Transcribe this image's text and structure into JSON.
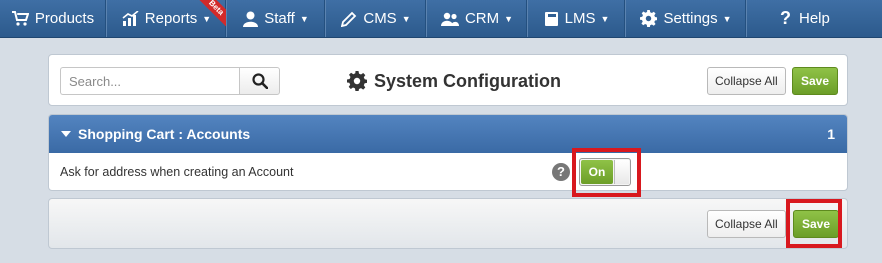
{
  "nav": {
    "items": [
      {
        "label": "Products",
        "icon": "cart-icon",
        "caret": false
      },
      {
        "label": "Reports",
        "icon": "chart-icon",
        "caret": true,
        "badge": "Beta"
      },
      {
        "label": "Staff",
        "icon": "person-icon",
        "caret": true
      },
      {
        "label": "CMS",
        "icon": "pencil-icon",
        "caret": true
      },
      {
        "label": "CRM",
        "icon": "people-icon",
        "caret": true
      },
      {
        "label": "LMS",
        "icon": "book-icon",
        "caret": true
      },
      {
        "label": "Settings",
        "icon": "gear-icon",
        "caret": true
      },
      {
        "label": "Help",
        "icon": "question-icon",
        "caret": false
      }
    ]
  },
  "toolbar": {
    "search_placeholder": "Search...",
    "title": "System Configuration",
    "collapse_label": "Collapse All",
    "save_label": "Save"
  },
  "section": {
    "title": "Shopping Cart : Accounts",
    "count": "1",
    "setting": {
      "label": "Ask for address when creating an Account",
      "help": "?",
      "toggle_label": "On",
      "toggle_state": true
    }
  },
  "footer": {
    "collapse_label": "Collapse All",
    "save_label": "Save"
  },
  "colors": {
    "nav": "#2f5e92",
    "section_header": "#4677b3",
    "save": "#7caf36",
    "highlight": "#d8181e"
  }
}
